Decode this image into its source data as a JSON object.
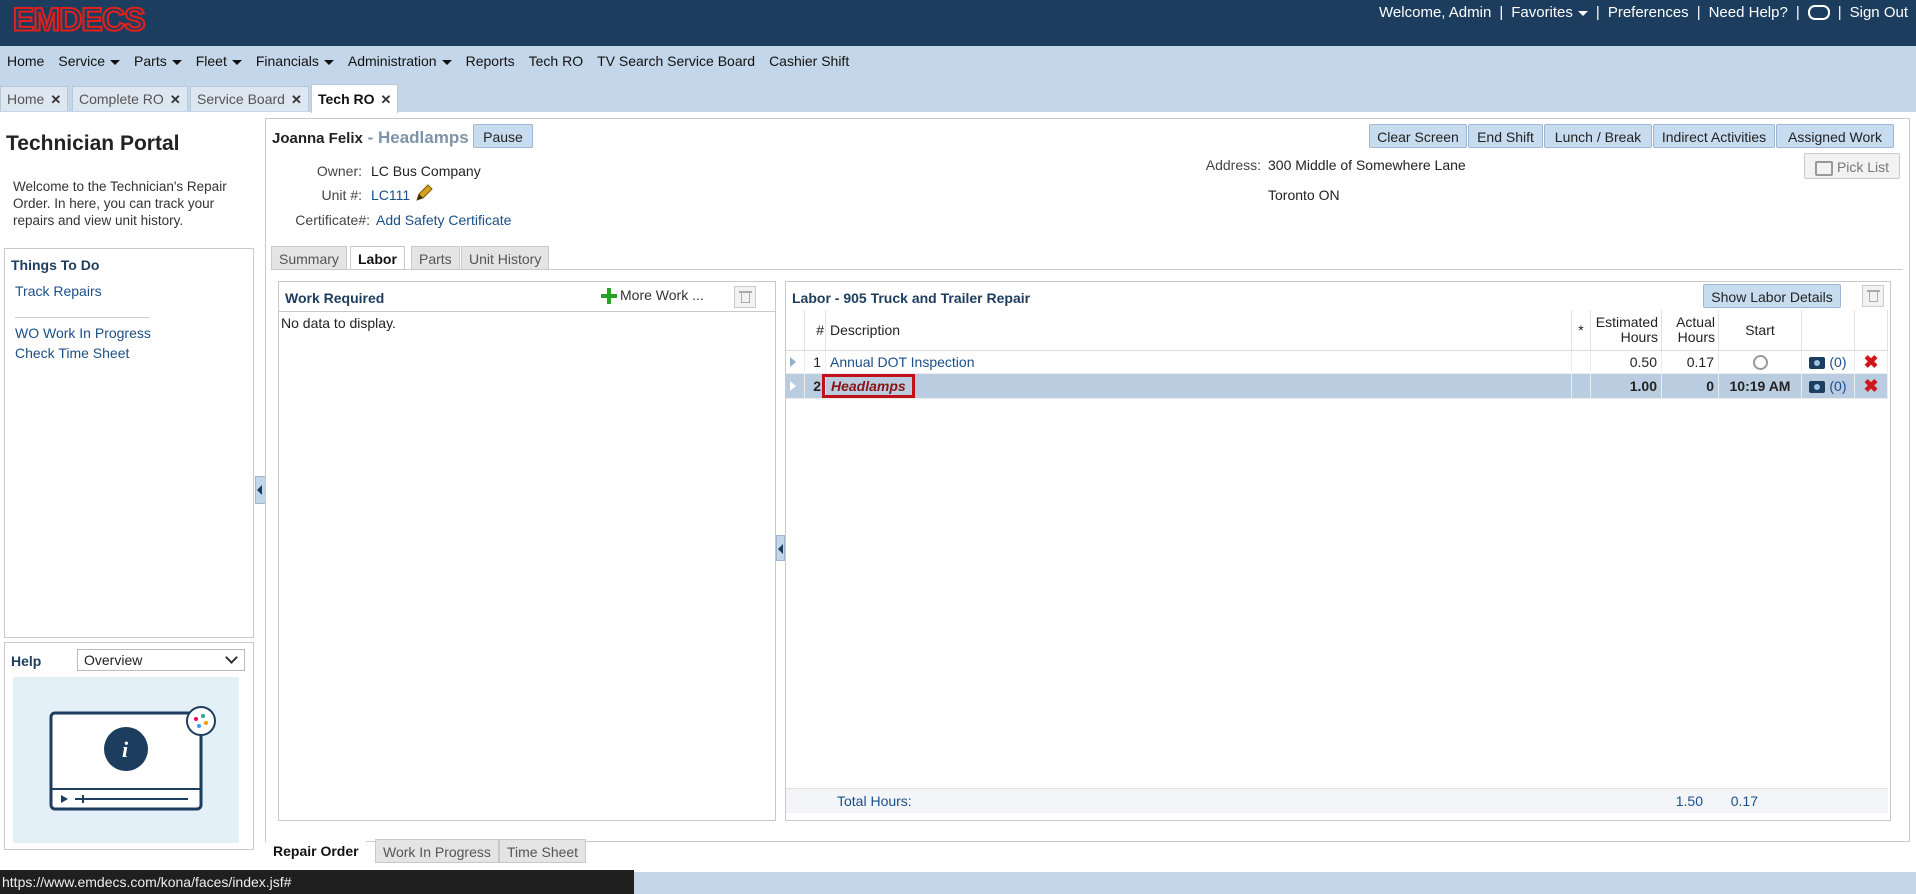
{
  "app": {
    "logo_text": "EMDECS"
  },
  "topbar": {
    "welcome": "Welcome, Admin",
    "links": [
      "Favorites",
      "Preferences",
      "Need Help?",
      "Sign Out"
    ]
  },
  "menu": [
    "Home",
    "Service",
    "Parts",
    "Fleet",
    "Financials",
    "Administration",
    "Reports",
    "Tech RO",
    "TV Search Service Board",
    "Cashier Shift"
  ],
  "page_tabs": [
    "Home",
    "Complete RO",
    "Service Board",
    "Tech RO"
  ],
  "sidebar": {
    "title": "Technician Portal",
    "description": "Welcome to the Technician's Repair Order. In here, you can track your repairs and view unit history.",
    "todo_title": "Things To Do",
    "todo_links": [
      "Track Repairs",
      "WO Work In Progress",
      "Check Time Sheet"
    ],
    "help_title": "Help",
    "help_selected": "Overview"
  },
  "header": {
    "tech_name": "Joanna Felix",
    "job_sep": " - ",
    "job": "Headlamps",
    "pause": "Pause",
    "owner_label": "Owner:",
    "owner": "LC Bus Company",
    "unit_label": "Unit #:",
    "unit": "LC111",
    "cert_label": "Certificate#:",
    "cert_link": "Add Safety Certificate",
    "address_label": "Address:",
    "address1": "300 Middle of Somewhere Lane",
    "address2": "Toronto ON",
    "actions": [
      "Clear Screen",
      "End Shift",
      "Lunch / Break",
      "Indirect Activities",
      "Assigned Work"
    ],
    "pick_list": "Pick List"
  },
  "inner_tabs": [
    "Summary",
    "Labor",
    "Parts",
    "Unit History"
  ],
  "work_required": {
    "title": "Work Required",
    "more_work": "More Work ...",
    "empty": "No data to display."
  },
  "labor": {
    "title": "Labor - 905 Truck and Trailer Repair",
    "show_details": "Show Labor Details",
    "columns": [
      "#",
      "Description",
      "*",
      "Estimated Hours",
      "Actual Hours",
      "Start"
    ],
    "rows": [
      {
        "num": "1",
        "description": "Annual DOT Inspection",
        "est": "0.50",
        "actual": "0.17",
        "start": "",
        "photos": "(0)"
      },
      {
        "num": "2",
        "description": "Headlamps",
        "est": "1.00",
        "actual": "0",
        "start": "10:19 AM",
        "photos": "(0)"
      }
    ],
    "total_label": "Total Hours:",
    "total_est": "1.50",
    "total_actual": "0.17"
  },
  "bottom_tabs": [
    "Repair Order",
    "Work In Progress",
    "Time Sheet"
  ],
  "status_url": "https://www.emdecs.com/kona/faces/index.jsf#",
  "colors": {
    "brand_red": "#e0201c",
    "topbar": "#1d3d5e",
    "menubar": "#c4d7ea",
    "accent_link": "#1a4f8a"
  }
}
